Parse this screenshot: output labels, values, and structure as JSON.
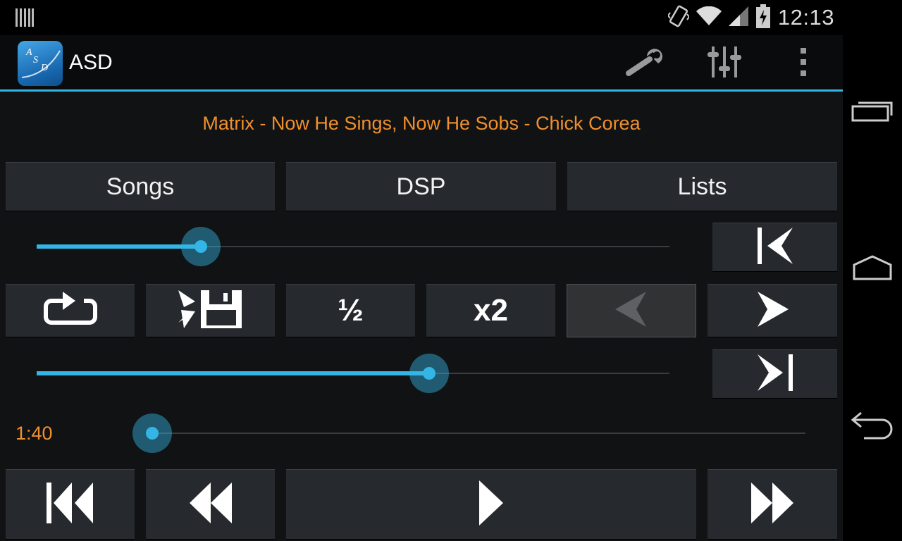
{
  "status_bar": {
    "time": "12:13",
    "icons": [
      "notification-bars-icon",
      "vibrate-icon",
      "wifi-icon",
      "signal-icon",
      "battery-charging-icon"
    ]
  },
  "action_bar": {
    "app_title": "ASD",
    "logo_letters": [
      "A",
      "S",
      "D"
    ],
    "actions": [
      "wrench-icon",
      "equalizer-icon",
      "overflow-menu-icon"
    ],
    "accent_color": "#33b5e5"
  },
  "now_playing": "Matrix - Now He Sings, Now He Sobs - Chick Corea",
  "tabs": [
    "Songs",
    "DSP",
    "Lists"
  ],
  "sliders": {
    "slider_1": 0.26,
    "slider_2": 0.62,
    "seek": 0.0
  },
  "controls_row": {
    "loop": "loop-icon",
    "save": "save-marks-icon",
    "half_speed_label": "½",
    "double_speed_label": "x2",
    "mark_prev": "arrow-left-icon",
    "mark_next": "arrow-right-icon",
    "mark_prev_disabled": true
  },
  "side_buttons": [
    "skip-to-start-icon",
    "skip-to-end-icon"
  ],
  "elapsed_time": "1:40",
  "transport": [
    "first-track-icon",
    "rewind-icon",
    "play-icon",
    "fast-forward-icon"
  ],
  "colors": {
    "title_text": "#f0902c",
    "slider": "#33b5e5",
    "button": "#26292d",
    "background": "#111214"
  }
}
